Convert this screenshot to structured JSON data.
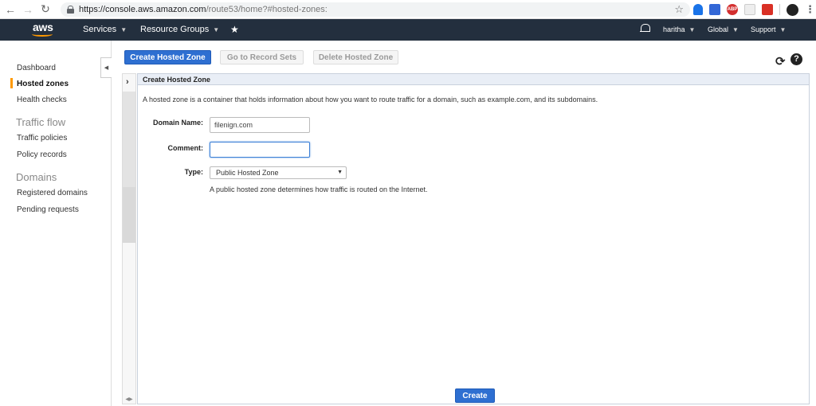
{
  "browser": {
    "url_host": "https://console.aws.amazon.com",
    "url_path": "/route53/home?#hosted-zones:",
    "ext_abp": "ABP"
  },
  "nav": {
    "logo": "aws",
    "services": "Services",
    "resource_groups": "Resource Groups",
    "user": "haritha",
    "region": "Global",
    "support": "Support"
  },
  "sidebar": {
    "dashboard": "Dashboard",
    "hosted_zones": "Hosted zones",
    "health_checks": "Health checks",
    "traffic_flow_heading": "Traffic flow",
    "traffic_policies": "Traffic policies",
    "policy_records": "Policy records",
    "domains_heading": "Domains",
    "registered_domains": "Registered domains",
    "pending_requests": "Pending requests"
  },
  "toolbar": {
    "create_hosted_zone": "Create Hosted Zone",
    "go_to_record_sets": "Go to Record Sets",
    "delete_hosted_zone": "Delete Hosted Zone"
  },
  "panel": {
    "title": "Create Hosted Zone",
    "description": "A hosted zone is a container that holds information about how you want to route traffic for a domain, such as example.com, and its subdomains.",
    "domain_label": "Domain Name:",
    "domain_value": "filenign.com",
    "comment_label": "Comment:",
    "comment_value": "",
    "type_label": "Type:",
    "type_value": "Public Hosted Zone",
    "type_help": "A public hosted zone determines how traffic is routed on the Internet.",
    "create_button": "Create"
  },
  "colors": {
    "aws_nav": "#232f3e",
    "accent_orange": "#ff9900",
    "primary_blue": "#2e6fd1"
  }
}
